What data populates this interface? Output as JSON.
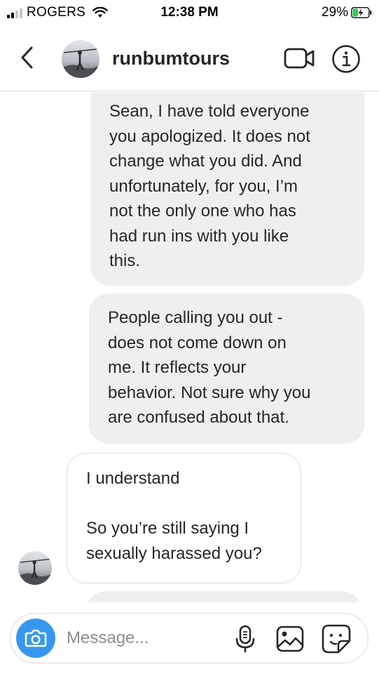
{
  "status_bar": {
    "carrier": "ROGERS",
    "time": "12:38 PM",
    "battery": "29%"
  },
  "header": {
    "username": "runbumtours",
    "icons": [
      "back-chevron-icon",
      "video-camera-icon",
      "info-icon"
    ]
  },
  "messages": [
    {
      "direction": "sent",
      "text": "Sean, I have told everyone\nyou apologized. It does not\nchange what you did. And\nunfortunately, for you, I’m\nnot the only one who has\nhad run ins with you like\nthis."
    },
    {
      "direction": "sent",
      "text": "People calling you out -\ndoes not come down on\nme. It reflects your\nbehavior. Not sure why you\nare confused about that."
    },
    {
      "direction": "received",
      "text": "I understand\n\nSo you’re still saying I\nsexually harassed you?"
    },
    {
      "direction": "sent",
      "text": ""
    }
  ],
  "composer": {
    "placeholder": "Message...",
    "icons": [
      "camera-icon",
      "microphone-icon",
      "gallery-icon",
      "sticker-icon"
    ]
  },
  "colors": {
    "sent_bubble": "#efefef",
    "received_border": "#dbdbdb",
    "camera_button": "#3797f0",
    "text": "#262626",
    "placeholder": "#8e8e8e"
  }
}
